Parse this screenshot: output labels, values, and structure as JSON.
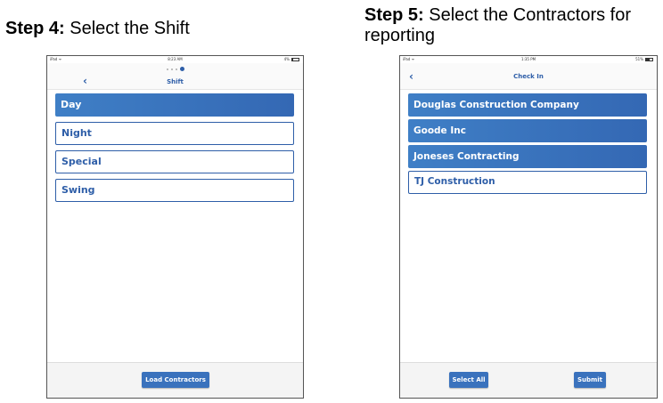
{
  "step4": {
    "label": "Step 4:",
    "text": " Select the Shift"
  },
  "step5": {
    "label": "Step 5:",
    "text": " Select the Contractors for reporting"
  },
  "device1": {
    "status": {
      "carrier": "iPad ᯤ",
      "time": "8:23 AM",
      "battery": "4%",
      "battery_level": 0.04
    },
    "nav": {
      "back": "‹",
      "title": "Shift"
    },
    "options": [
      {
        "label": "Day",
        "selected": true
      },
      {
        "label": "Night",
        "selected": false
      },
      {
        "label": "Special",
        "selected": false
      },
      {
        "label": "Swing",
        "selected": false
      }
    ],
    "button": "Load Contractors"
  },
  "device2": {
    "status": {
      "carrier": "iPad ᯤ",
      "time": "1:35 PM",
      "battery": "51%",
      "battery_level": 0.51
    },
    "nav": {
      "back": "‹",
      "title": "Check In"
    },
    "options": [
      {
        "label": "Douglas Construction Company",
        "selected": true
      },
      {
        "label": "Goode Inc",
        "selected": true
      },
      {
        "label": "Joneses Contracting",
        "selected": true
      },
      {
        "label": "TJ Construction",
        "selected": false
      }
    ],
    "buttons": {
      "select_all": "Select All",
      "submit": "Submit"
    }
  },
  "colors": {
    "accent": "#2e5ea8",
    "selected_fill": "#3a72bd"
  }
}
